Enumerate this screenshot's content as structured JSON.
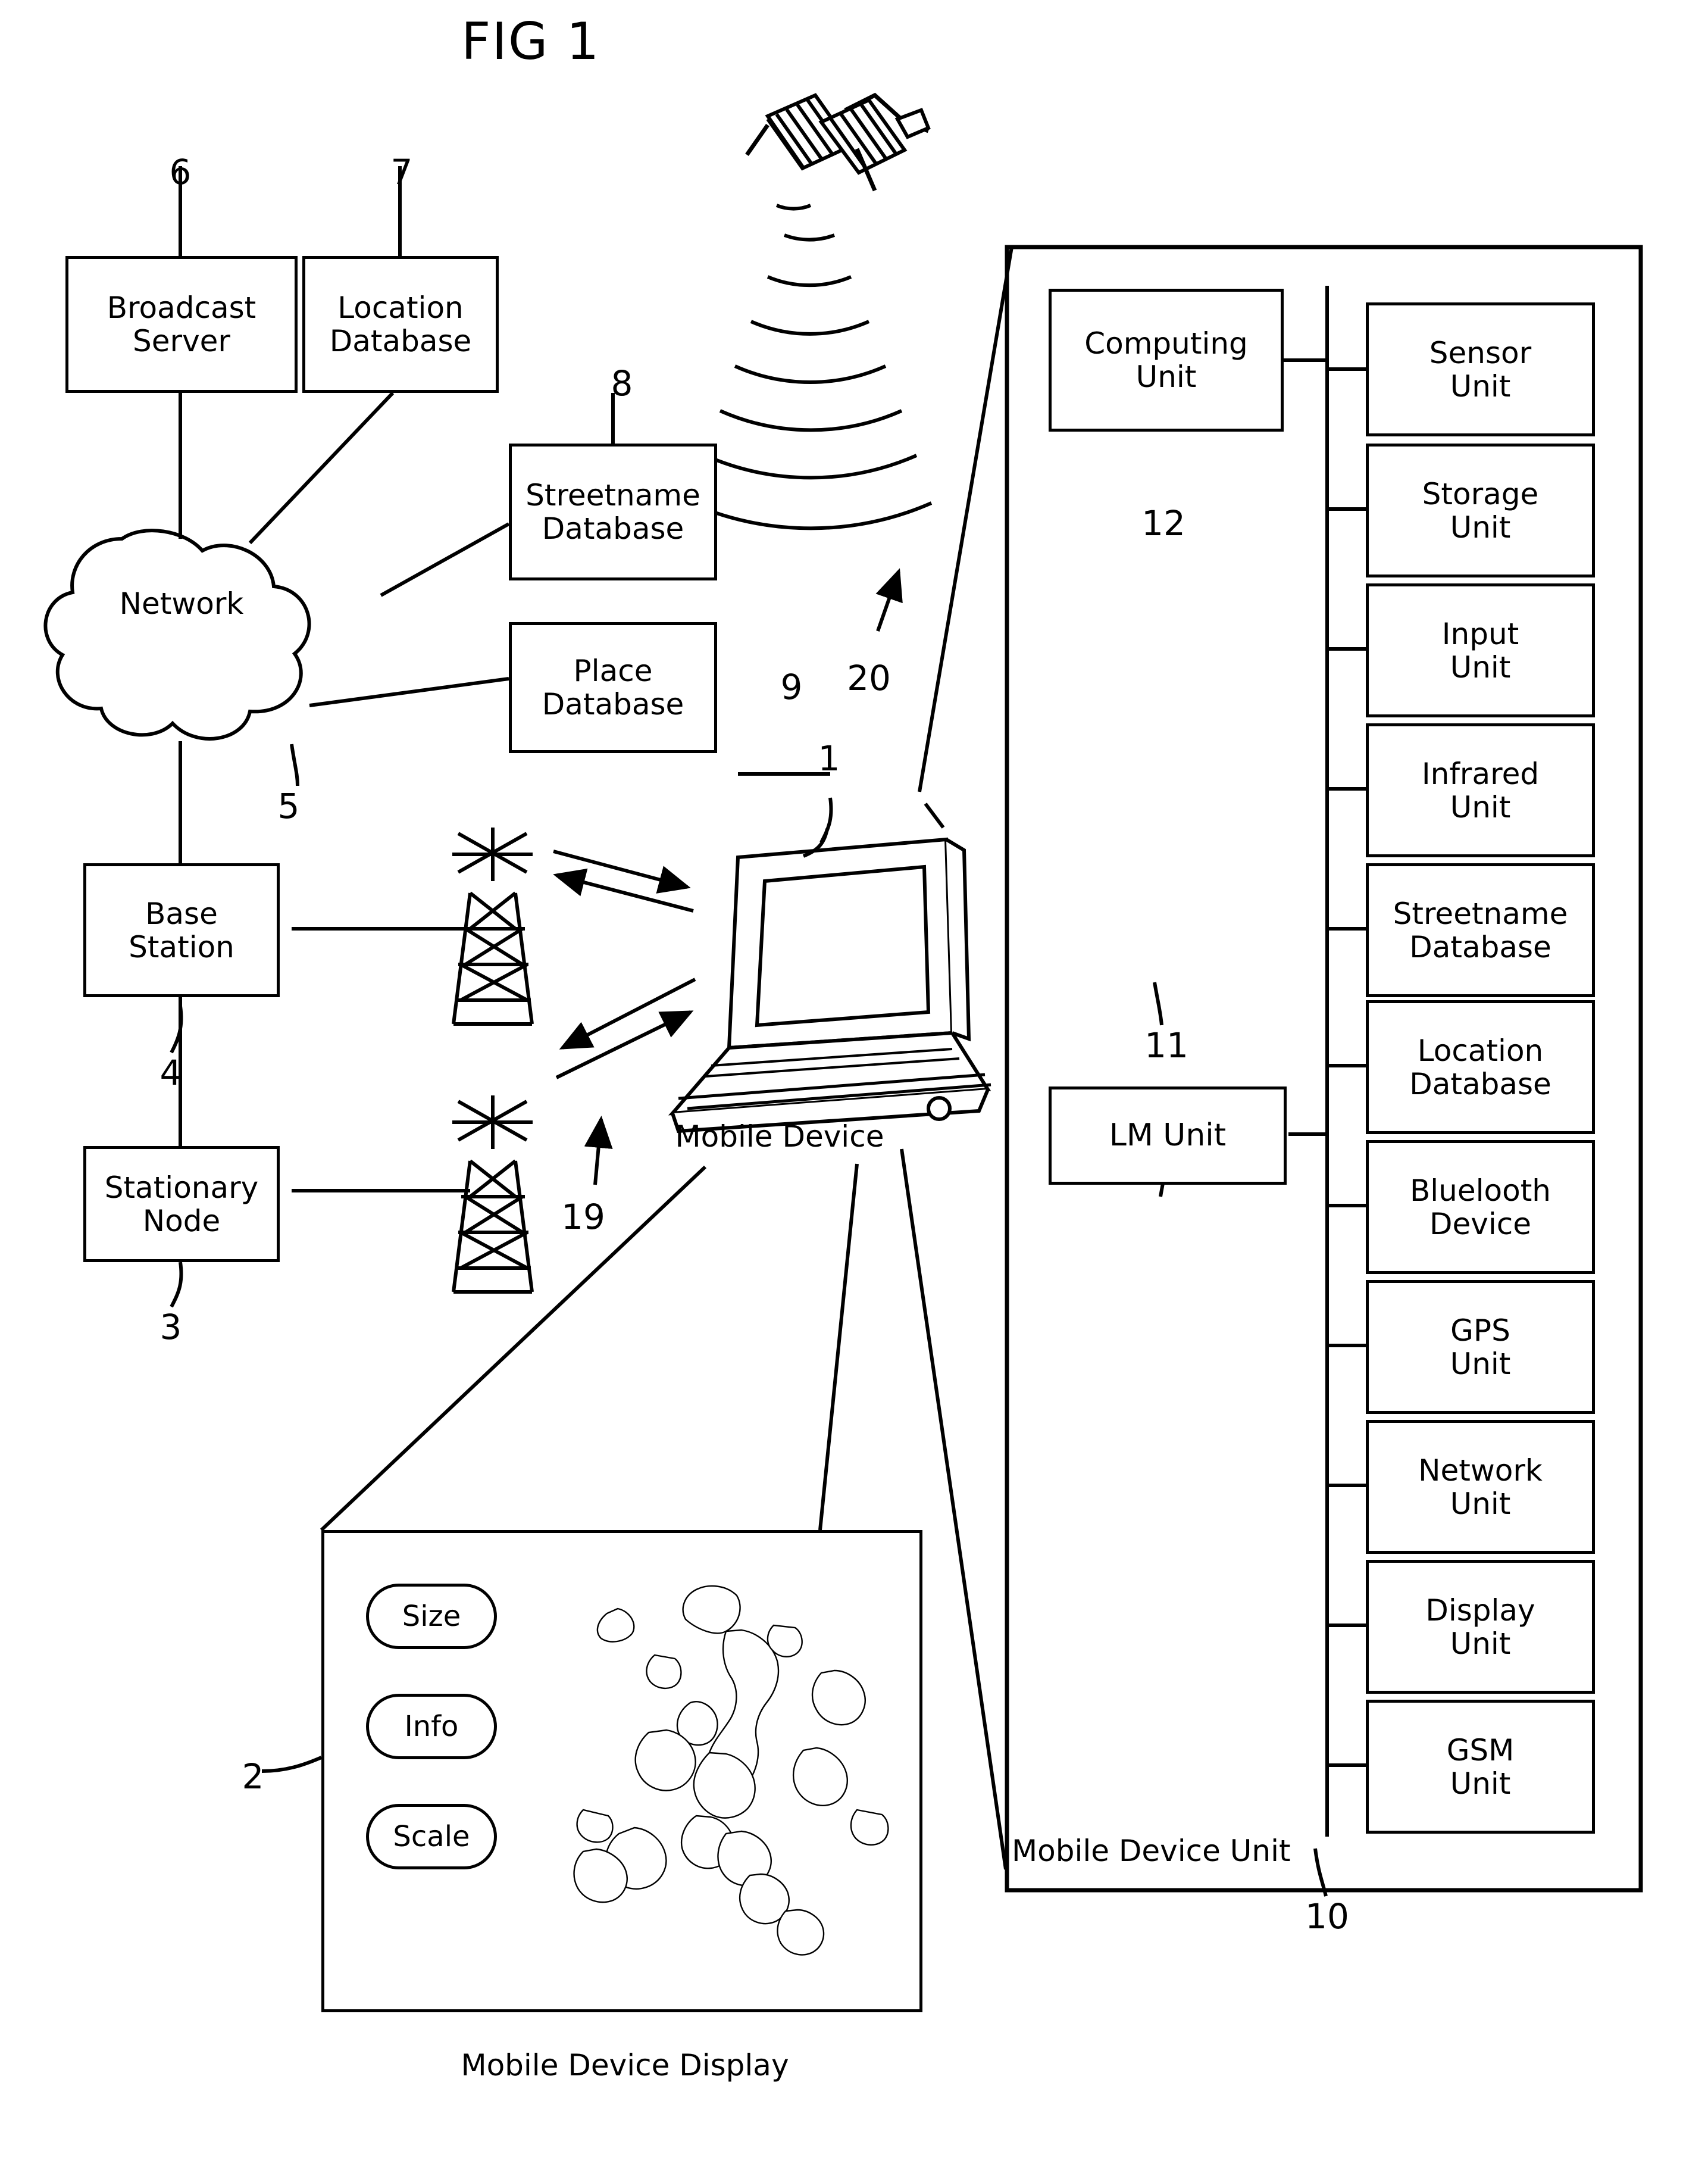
{
  "figure": {
    "title": "FIG 1"
  },
  "left_network": {
    "broadcast_server": {
      "line1": "Broadcast",
      "line2": "Server",
      "ref": "6"
    },
    "location_database": {
      "line1": "Location",
      "line2": "Database",
      "ref": "7"
    },
    "streetname_database": {
      "line1": "Streetname",
      "line2": "Database",
      "ref": "8"
    },
    "place_database": {
      "line1": "Place",
      "line2": "Database",
      "ref": "9"
    },
    "network_cloud": {
      "label": "Network",
      "ref": "5"
    },
    "base_station": {
      "line1": "Base",
      "line2": "Station",
      "ref": "4"
    },
    "stationary_node": {
      "line1": "Stationary",
      "line2": "Node",
      "ref": "3"
    }
  },
  "center": {
    "mobile_device_label": "Mobile Device",
    "mobile_device_ref": "1",
    "satellite_link_ref": "20",
    "antenna_link_ref": "19"
  },
  "mobile_device_unit": {
    "title": "Mobile Device Unit",
    "ref": "10",
    "computing_unit": {
      "line1": "Computing",
      "line2": "Unit",
      "ref": "12"
    },
    "lm_unit": {
      "label": "LM Unit",
      "ref": "11"
    },
    "modules": [
      {
        "line1": "Sensor",
        "line2": "Unit"
      },
      {
        "line1": "Storage",
        "line2": "Unit"
      },
      {
        "line1": "Input",
        "line2": "Unit"
      },
      {
        "line1": "Infrared",
        "line2": "Unit"
      },
      {
        "line1": "Streetname",
        "line2": "Database"
      },
      {
        "line1": "Location",
        "line2": "Database"
      },
      {
        "line1": "Bluelooth",
        "line2": "Device"
      },
      {
        "line1": "GPS",
        "line2": "Unit"
      },
      {
        "line1": "Network",
        "line2": "Unit"
      },
      {
        "line1": "Display",
        "line2": "Unit"
      },
      {
        "line1": "GSM",
        "line2": "Unit"
      }
    ]
  },
  "display_panel": {
    "caption": "Mobile Device Display",
    "ref": "2",
    "buttons": [
      {
        "label": "Size"
      },
      {
        "label": "Info"
      },
      {
        "label": "Scale"
      }
    ]
  }
}
